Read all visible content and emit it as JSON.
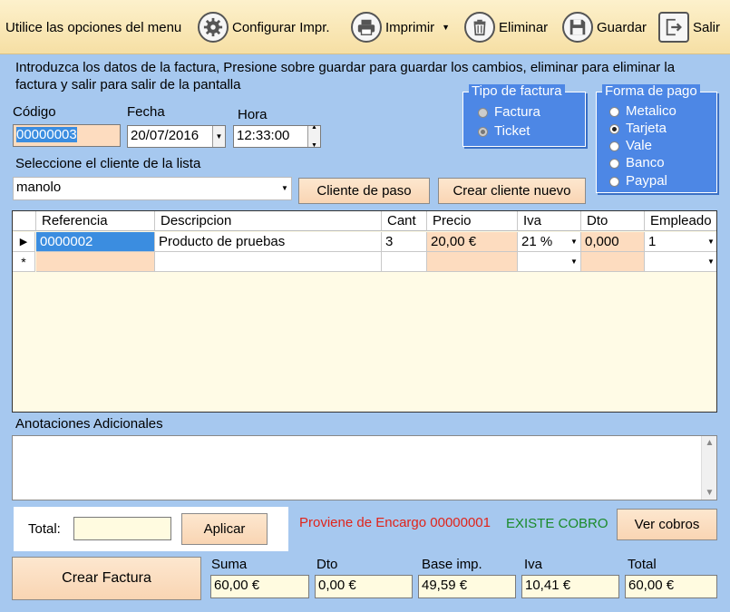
{
  "toolbar": {
    "prompt": "Utilice las opciones del menu",
    "configurar": "Configurar Impr.",
    "imprimir": "Imprimir",
    "eliminar": "Eliminar",
    "guardar": "Guardar",
    "salir": "Salir"
  },
  "instructions": "Introduzca los datos de la factura, Presione sobre guardar para guardar los cambios, eliminar para eliminar la factura y salir para salir de la pantalla",
  "codigo": {
    "label": "Código",
    "value": "00000003"
  },
  "fecha": {
    "label": "Fecha",
    "value": "20/07/2016"
  },
  "hora": {
    "label": "Hora",
    "value": "12:33:00"
  },
  "tipo_factura": {
    "title": "Tipo de factura",
    "options": [
      "Factura",
      "Ticket"
    ],
    "selected": "Ticket"
  },
  "forma_pago": {
    "title": "Forma de pago",
    "options": [
      "Metalico",
      "Tarjeta",
      "Vale",
      "Banco",
      "Paypal"
    ],
    "selected": "Tarjeta"
  },
  "cliente": {
    "label": "Seleccione el cliente de la lista",
    "value": "manolo",
    "btn_paso": "Cliente de paso",
    "btn_nuevo": "Crear cliente nuevo"
  },
  "grid": {
    "columns": [
      "Referencia",
      "Descripcion",
      "Cant",
      "Precio",
      "Iva",
      "Dto",
      "Empleado"
    ],
    "rows": [
      {
        "marker": "▶",
        "referencia": "0000002",
        "descripcion": "Producto de pruebas",
        "cant": "3",
        "precio": "20,00 €",
        "iva": "21 %",
        "dto": "0,000",
        "empleado": "1"
      }
    ],
    "new_row_marker": "*"
  },
  "anotaciones_label": "Anotaciones Adicionales",
  "total_panel": {
    "label": "Total:",
    "value": "",
    "btn_aplicar": "Aplicar"
  },
  "encargo_text": "Proviene de Encargo 00000001",
  "cobro_status": "EXISTE COBRO",
  "btn_ver_cobros": "Ver cobros",
  "btn_crear_factura": "Crear Factura",
  "totals": {
    "suma": {
      "label": "Suma",
      "value": "60,00 €"
    },
    "dto": {
      "label": "Dto",
      "value": "0,00 €"
    },
    "base": {
      "label": "Base imp.",
      "value": "49,59 €"
    },
    "iva": {
      "label": "Iva",
      "value": "10,41 €"
    },
    "total": {
      "label": "Total",
      "value": "60,00 €"
    }
  },
  "colors": {
    "background": "#a6c8ef",
    "toolbar": "#f6dfa4",
    "groupbox": "#4d87e5",
    "encargo": "#e0241a",
    "cobro": "#1a8a2a",
    "selection": "#3b8de0"
  }
}
